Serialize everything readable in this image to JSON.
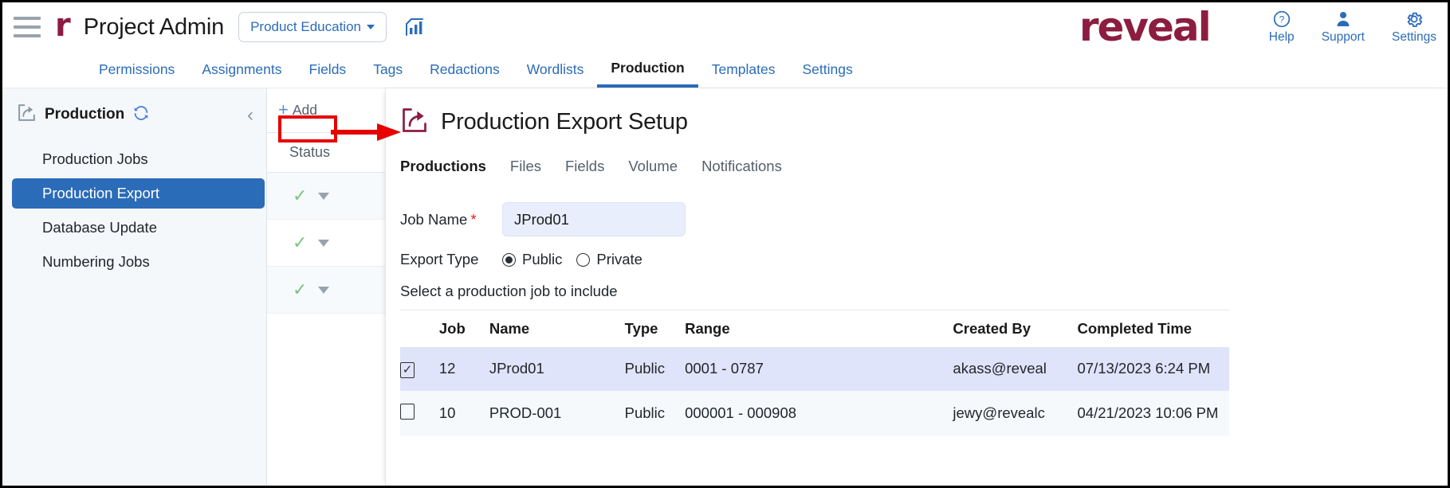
{
  "header": {
    "menu_icon": "hamburger-menu-icon",
    "brand_mark": "r",
    "app_title": "Project Admin",
    "project_selector": "Product Education",
    "analytics_icon": "chart-bar-icon",
    "logo_text": "reveal",
    "actions": [
      {
        "label": "Help",
        "icon": "help-circle-icon"
      },
      {
        "label": "Support",
        "icon": "support-person-icon"
      },
      {
        "label": "Settings",
        "icon": "gear-icon"
      }
    ]
  },
  "nav": {
    "tabs": [
      {
        "label": "Permissions",
        "active": false
      },
      {
        "label": "Assignments",
        "active": false
      },
      {
        "label": "Fields",
        "active": false
      },
      {
        "label": "Tags",
        "active": false
      },
      {
        "label": "Redactions",
        "active": false
      },
      {
        "label": "Wordlists",
        "active": false
      },
      {
        "label": "Production",
        "active": true
      },
      {
        "label": "Templates",
        "active": false
      },
      {
        "label": "Settings",
        "active": false
      }
    ]
  },
  "sidebar": {
    "title": "Production",
    "export_icon": "production-export-icon",
    "refresh_icon": "refresh-icon",
    "collapse_icon": "chevron-left-icon",
    "items": [
      {
        "label": "Production Jobs",
        "selected": false
      },
      {
        "label": "Production Export",
        "selected": true
      },
      {
        "label": "Database Update",
        "selected": false
      },
      {
        "label": "Numbering Jobs",
        "selected": false
      }
    ]
  },
  "list_panel": {
    "add_label": "Add",
    "add_plus": "+",
    "status_header": "Status",
    "rows": [
      {
        "status_icon": "green-check-icon",
        "caret": "caret-down-icon"
      },
      {
        "status_icon": "green-check-icon",
        "caret": "caret-down-icon"
      },
      {
        "status_icon": "green-check-icon",
        "caret": "caret-down-icon"
      }
    ]
  },
  "main": {
    "title": "Production Export Setup",
    "title_icon": "production-export-icon",
    "tabs": [
      {
        "label": "Productions",
        "active": true
      },
      {
        "label": "Files",
        "active": false
      },
      {
        "label": "Fields",
        "active": false
      },
      {
        "label": "Volume",
        "active": false
      },
      {
        "label": "Notifications",
        "active": false
      }
    ],
    "job_name": {
      "label": "Job Name",
      "required_marker": "*",
      "value": "JProd01",
      "placeholder": "Job Name"
    },
    "export_type": {
      "label": "Export Type",
      "options": [
        {
          "label": "Public",
          "selected": true
        },
        {
          "label": "Private",
          "selected": false
        }
      ]
    },
    "select_hint": "Select a production job to include",
    "table": {
      "columns": [
        "",
        "Job",
        "Name",
        "Type",
        "Range",
        "Created By",
        "Completed Time"
      ],
      "rows": [
        {
          "checked": true,
          "check_glyph": "✓",
          "job": "12",
          "name": "JProd01",
          "type": "Public",
          "range": "0001 - 0787",
          "created_by": "akass@reveal",
          "completed_time": "07/13/2023 6:24 PM",
          "selected": true
        },
        {
          "checked": false,
          "check_glyph": "",
          "job": "10",
          "name": "PROD-001",
          "type": "Public",
          "range": "000001 - 000908",
          "created_by": "jewy@revealc",
          "completed_time": "04/21/2023 10:06 PM",
          "selected": false
        }
      ]
    }
  },
  "annotations": {
    "highlight_target": "add-button",
    "arrow_direction": "right",
    "color": "#e60000"
  },
  "colors": {
    "brand_maroon": "#8c1d40",
    "link_blue": "#2b6cb8",
    "selected_nav": "#2b6cb8",
    "row_selected": "#dfe4fa",
    "input_bg": "#e8eefb",
    "status_green": "#79c67f",
    "annotation_red": "#e60000"
  }
}
